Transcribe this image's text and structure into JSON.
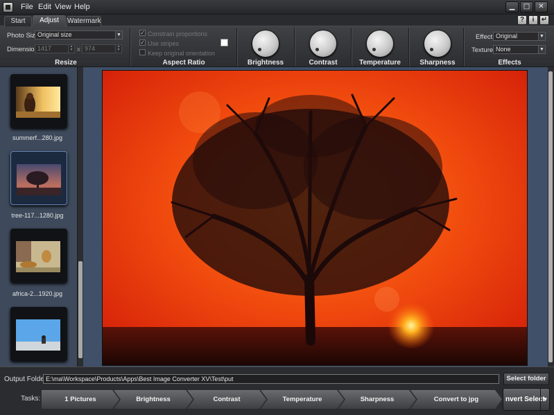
{
  "menu": {
    "file": "File",
    "edit": "Edit",
    "view": "View",
    "help": "Help"
  },
  "window_buttons": {
    "minimize": "▁",
    "maximize": "□",
    "close": "✕"
  },
  "tabs": [
    {
      "label": "Start",
      "active": false
    },
    {
      "label": "Adjust",
      "active": true
    },
    {
      "label": "Watermark",
      "active": false
    }
  ],
  "resize": {
    "title": "Resize",
    "photo_size_label": "Photo Size:",
    "photo_size_value": "Original size",
    "dimension_label": "Dimension:",
    "width": "1417",
    "height": "974",
    "separator": "x"
  },
  "aspect": {
    "title": "Aspect Ratio",
    "constrain": "Constrain proportions",
    "use_stripes": "Use stripes",
    "keep_orientation": "Keep original orientation",
    "stripe_color": "#ffffff"
  },
  "knobs": {
    "brightness": "Brightness",
    "contrast": "Contrast",
    "temperature": "Temperature",
    "sharpness": "Sharpness"
  },
  "effects": {
    "title": "Effects",
    "effect_label": "Effect:",
    "effect_value": "Original",
    "texture_label": "Texture:",
    "texture_value": "None"
  },
  "thumbnails": [
    {
      "name": "summerf...280.jpg",
      "selected": false
    },
    {
      "name": "tree-117...1280.jpg",
      "selected": true
    },
    {
      "name": "africa-2...1920.jpg",
      "selected": false
    },
    {
      "name": "",
      "selected": false
    }
  ],
  "output": {
    "label": "Output Folder:",
    "path": "E:\\ma\\Workspace\\Products\\Apps\\Best Image Converter XV\\Test\\put",
    "select_button": "Select folder ..."
  },
  "tasks": {
    "label": "Tasks:",
    "steps": [
      "1 Pictures",
      "Brightness",
      "Contrast",
      "Temperature",
      "Sharpness",
      "Convert to jpg"
    ],
    "convert_button": "nvert Select",
    "arrow": "▼"
  },
  "colors": {
    "accent": "#6b86b4",
    "panel": "#3e4a5c",
    "sunset": "#e8340d"
  }
}
